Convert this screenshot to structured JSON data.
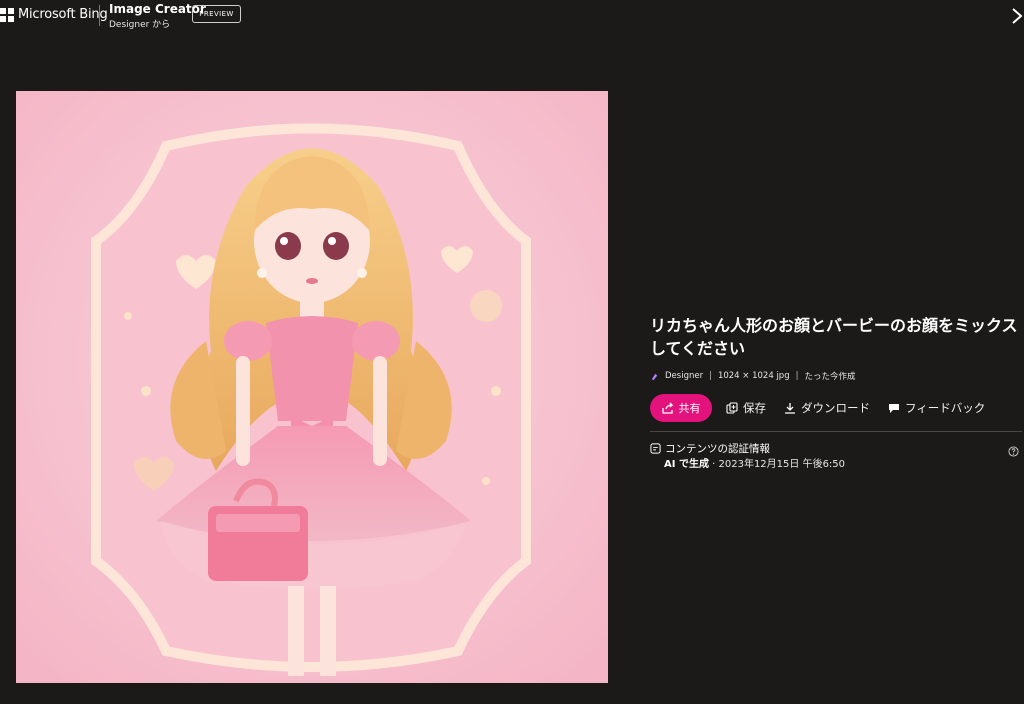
{
  "header": {
    "brand": "Microsoft Bing",
    "app_title": "Image Creator",
    "app_subtitle": "Designer から",
    "preview_label": "PREVIEW"
  },
  "image": {
    "alt": "リカちゃん人形のお顔とバービーのお顔をミックスしてください"
  },
  "panel": {
    "title": "リカちゃん人形のお顔とバービーのお顔をミックスしてください",
    "meta_source": "Designer",
    "meta_size": "1024 × 1024 jpg",
    "meta_time": "たった今作成",
    "actions": {
      "share": "共有",
      "save": "保存",
      "download": "ダウンロード",
      "feedback": "フィードバック"
    },
    "credentials": {
      "label": "コンテンツの認証情報",
      "generated": "AI で生成",
      "date": " · 2023年12月15日 午後6:50"
    }
  },
  "colors": {
    "background": "#1b1a19",
    "accent": "#e3127d"
  },
  "icons": [
    "microsoft-logo",
    "close-icon",
    "chevron-left-icon",
    "designer-icon",
    "share-icon",
    "save-icon",
    "download-icon",
    "feedback-icon",
    "credentials-icon",
    "help-icon"
  ]
}
